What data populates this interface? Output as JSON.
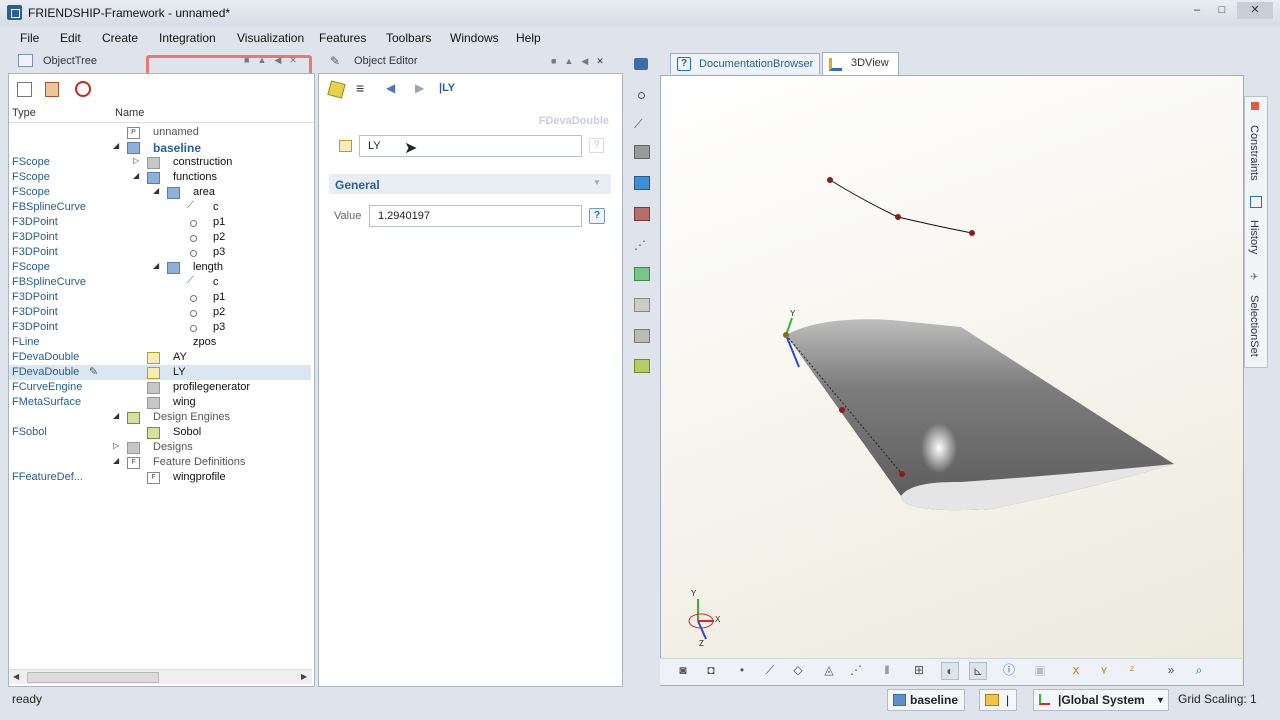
{
  "window": {
    "title": "FRIENDSHIP-Framework - unnamed*",
    "min": "–",
    "max": "□",
    "close": "✕"
  },
  "menu": [
    "File",
    "Edit",
    "Create",
    "Integration",
    "Visualization",
    "Features",
    "Toolbars",
    "Windows",
    "Help"
  ],
  "object_tree": {
    "title": "ObjectTree",
    "col_type": "Type",
    "col_name": "Name",
    "rows": [
      {
        "type": "",
        "name": "unnamed",
        "depth": 0
      },
      {
        "type": "",
        "name": "baseline",
        "depth": 0
      },
      {
        "type": "FScope",
        "name": "construction",
        "depth": 1
      },
      {
        "type": "FScope",
        "name": "functions",
        "depth": 1
      },
      {
        "type": "FScope",
        "name": "area",
        "depth": 2
      },
      {
        "type": "FBSplineCurve",
        "name": "c",
        "depth": 3
      },
      {
        "type": "F3DPoint",
        "name": "p1",
        "depth": 3
      },
      {
        "type": "F3DPoint",
        "name": "p2",
        "depth": 3
      },
      {
        "type": "F3DPoint",
        "name": "p3",
        "depth": 3
      },
      {
        "type": "FScope",
        "name": "length",
        "depth": 2
      },
      {
        "type": "FBSplineCurve",
        "name": "c",
        "depth": 3
      },
      {
        "type": "F3DPoint",
        "name": "p1",
        "depth": 3
      },
      {
        "type": "F3DPoint",
        "name": "p2",
        "depth": 3
      },
      {
        "type": "F3DPoint",
        "name": "p3",
        "depth": 3
      },
      {
        "type": "FLine",
        "name": "zpos",
        "depth": 2
      },
      {
        "type": "FDevaDouble",
        "name": "AY",
        "depth": 1
      },
      {
        "type": "FDevaDouble",
        "name": "LY",
        "depth": 1
      },
      {
        "type": "FCurveEngine",
        "name": "profilegenerator",
        "depth": 1
      },
      {
        "type": "FMetaSurface",
        "name": "wing",
        "depth": 1
      },
      {
        "type": "",
        "name": "Design Engines",
        "depth": 0
      },
      {
        "type": "FSobol",
        "name": "Sobol",
        "depth": 1
      },
      {
        "type": "",
        "name": "Designs",
        "depth": 0
      },
      {
        "type": "",
        "name": "Feature Definitions",
        "depth": 0
      },
      {
        "type": "FFeatureDef...",
        "name": "wingprofile",
        "depth": 1
      }
    ]
  },
  "object_editor": {
    "title": "Object Editor",
    "crumb": "|LY",
    "class_label": "FDevaDouble",
    "name_value": "LY",
    "section": "General",
    "value_label": "Value",
    "value": "1.2940197",
    "help": "?"
  },
  "view": {
    "tab_doc": "DocumentationBrowser",
    "tab_3d": "3DView",
    "side_tabs": [
      "Constraints",
      "History",
      "SelectionSet"
    ],
    "axes": {
      "x": "X",
      "y": "Y",
      "z": "Z"
    },
    "more": "»"
  },
  "status": {
    "text": "ready",
    "scope": "baseline",
    "folder_sep": "|",
    "coord": "|Global System",
    "grid": "Grid Scaling: 1"
  },
  "colors": {
    "accent": "#2b5f95",
    "highlight": "#e0675c",
    "surface": "#8c8c8c"
  }
}
